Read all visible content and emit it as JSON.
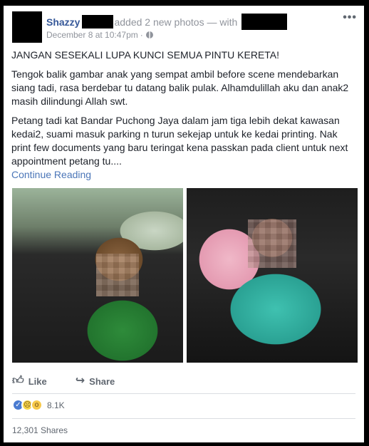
{
  "post": {
    "author": "Shazzy",
    "action": "added 2 new photos — with",
    "timestamp": "December 8 at 10:47pm",
    "menu_icon": "•••",
    "paragraphs": [
      "JANGAN SESEKALI LUPA KUNCI SEMUA PINTU KERETA!",
      "Tengok balik gambar anak yang sempat ambil before scene mendebarkan siang tadi, rasa berdebar tu datang balik pulak. Alhamdulillah aku dan anak2 masih dilindungi Allah swt.",
      "Petang tadi kat Bandar Puchong Jaya dalam jam tiga lebih dekat kawasan kedai2, suami masuk parking n turun sekejap untuk ke kedai printing. Nak print few documents yang baru teringat kena passkan pada client untuk next appointment petang tu...."
    ],
    "continue_label": "Continue Reading"
  },
  "actions": {
    "like_label": "Like",
    "share_label": "Share",
    "like_icon": "thumbs-up-icon",
    "share_icon": "share-arrow-icon"
  },
  "reactions": {
    "count": "8.1K",
    "types": [
      "like",
      "sad",
      "wow"
    ]
  },
  "shares": {
    "label": "12,301 Shares"
  },
  "colors": {
    "link": "#365899",
    "meta": "#90949c",
    "text": "#1d2129",
    "continue": "#4b76b8"
  }
}
